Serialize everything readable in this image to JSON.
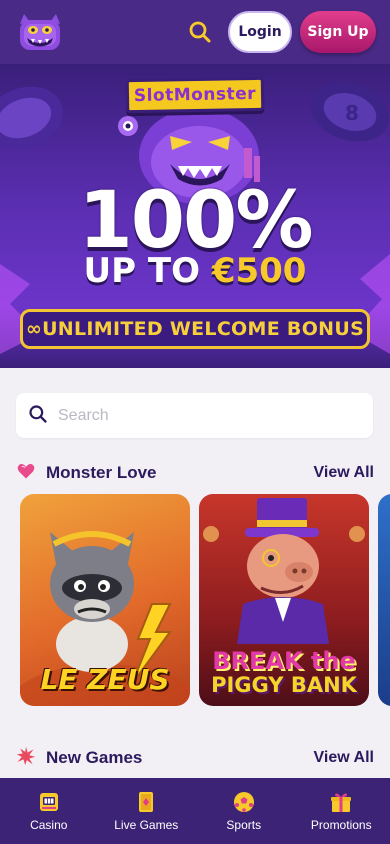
{
  "header": {
    "login_label": "Login",
    "signup_label": "Sign Up"
  },
  "hero": {
    "brand": "SlotMonster",
    "headline": "100%",
    "upto_prefix": "UP TO ",
    "upto_amount": "€500",
    "bonus_text": "∞UNLIMITED WELCOME BONUS"
  },
  "search": {
    "placeholder": "Search"
  },
  "sections": [
    {
      "title": "Monster Love",
      "view_all": "View All"
    },
    {
      "title": "New Games",
      "view_all": "View All"
    }
  ],
  "games": [
    {
      "title": "LE ZEUS"
    },
    {
      "title_line1": "BREAK the",
      "title_line2": "PIGGY BANK"
    }
  ],
  "bottom_nav": [
    {
      "label": "Casino",
      "icon": "slot-machine-icon"
    },
    {
      "label": "Live Games",
      "icon": "playing-card-icon"
    },
    {
      "label": "Sports",
      "icon": "soccer-ball-icon"
    },
    {
      "label": "Promotions",
      "icon": "gift-icon"
    }
  ],
  "colors": {
    "header_bg": "#4a2a87",
    "accent_yellow": "#f7c92a",
    "signup_pink": "#e23d8c",
    "text_dark": "#2c1a5e",
    "nav_bg": "#3d2376"
  }
}
